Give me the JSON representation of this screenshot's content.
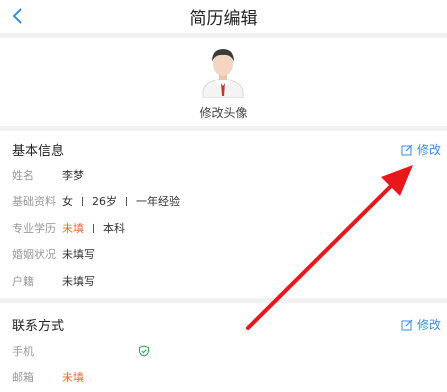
{
  "header": {
    "title": "简历编辑"
  },
  "avatar": {
    "label": "修改头像"
  },
  "basic": {
    "title": "基本信息",
    "edit_label": "修改",
    "name": {
      "label": "姓名",
      "value": "李梦"
    },
    "profile": {
      "label": "基础资料",
      "gender": "女",
      "age": "26岁",
      "experience": "一年经验"
    },
    "education": {
      "label": "专业学历",
      "major": "未填",
      "degree": "本科"
    },
    "marital": {
      "label": "婚姻状况",
      "value": "未填写"
    },
    "hukou": {
      "label": "户籍",
      "value": "未填写"
    }
  },
  "contact": {
    "title": "联系方式",
    "edit_label": "修改",
    "phone": {
      "label": "手机",
      "value": ""
    },
    "email": {
      "label": "邮箱",
      "value": "未填"
    }
  },
  "colors": {
    "accent": "#3a8ee6",
    "warning": "#f06a2f",
    "arrow": "#e8171a"
  }
}
